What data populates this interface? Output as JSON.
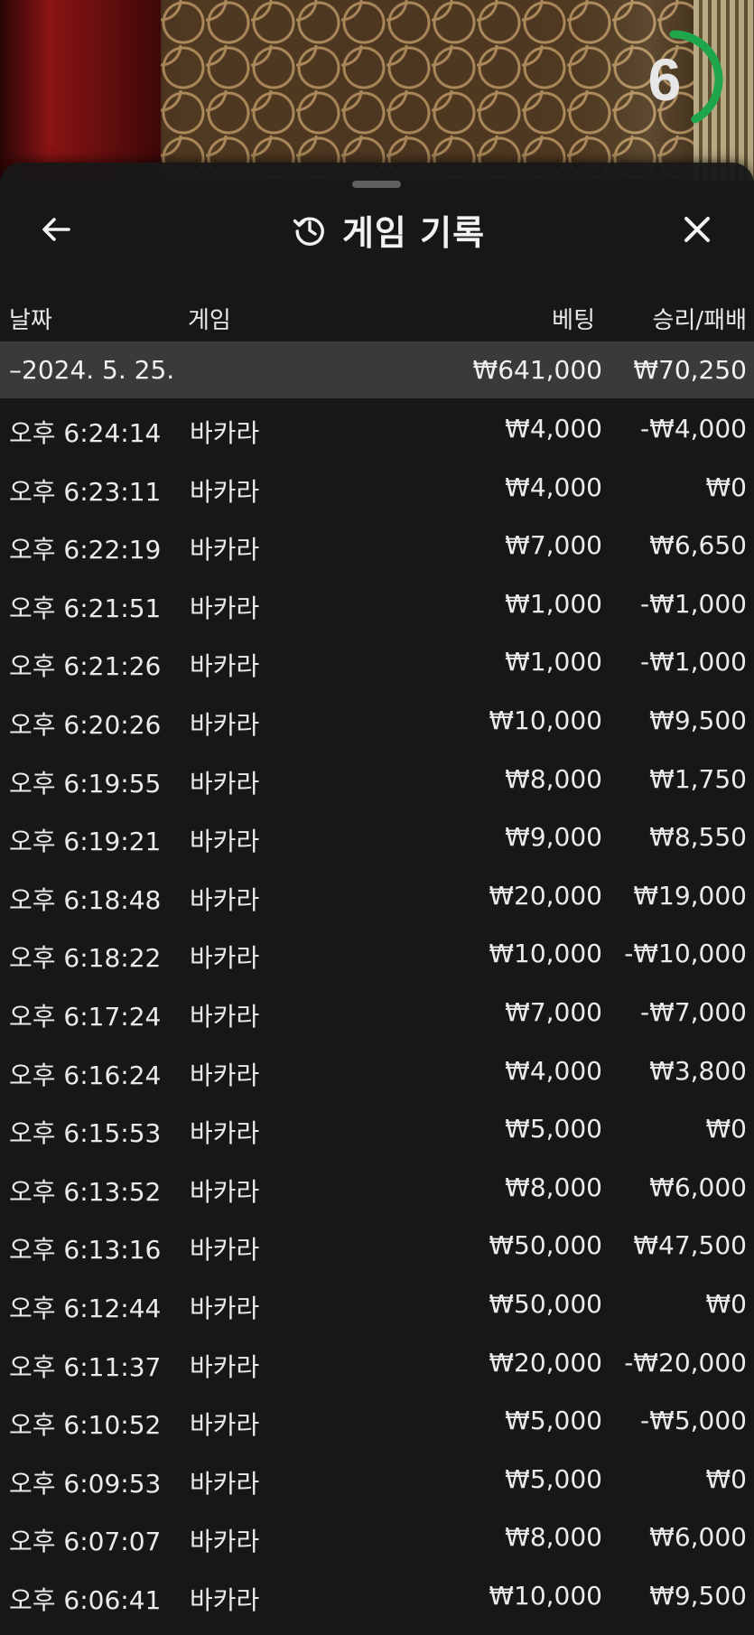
{
  "timer": {
    "value": "6",
    "accent": "#1fa64a",
    "progress": 0.42
  },
  "header": {
    "title": "게임 기록",
    "back_icon": "arrow-left-icon",
    "history_icon": "history-icon",
    "close_icon": "close-icon"
  },
  "columns": {
    "date": "날짜",
    "game": "게임",
    "bet": "베팅",
    "win_loss": "승리/패배"
  },
  "summary": {
    "date": "–2024. 5. 25.",
    "bet": "₩641,000",
    "win_loss": "₩70,250"
  },
  "rows": [
    {
      "time": "오후 6:24:14",
      "game": "바카라",
      "bet": "₩4,000",
      "win_loss": "-₩4,000"
    },
    {
      "time": "오후 6:23:11",
      "game": "바카라",
      "bet": "₩4,000",
      "win_loss": "₩0"
    },
    {
      "time": "오후 6:22:19",
      "game": "바카라",
      "bet": "₩7,000",
      "win_loss": "₩6,650"
    },
    {
      "time": "오후 6:21:51",
      "game": "바카라",
      "bet": "₩1,000",
      "win_loss": "-₩1,000"
    },
    {
      "time": "오후 6:21:26",
      "game": "바카라",
      "bet": "₩1,000",
      "win_loss": "-₩1,000"
    },
    {
      "time": "오후 6:20:26",
      "game": "바카라",
      "bet": "₩10,000",
      "win_loss": "₩9,500"
    },
    {
      "time": "오후 6:19:55",
      "game": "바카라",
      "bet": "₩8,000",
      "win_loss": "₩1,750"
    },
    {
      "time": "오후 6:19:21",
      "game": "바카라",
      "bet": "₩9,000",
      "win_loss": "₩8,550"
    },
    {
      "time": "오후 6:18:48",
      "game": "바카라",
      "bet": "₩20,000",
      "win_loss": "₩19,000"
    },
    {
      "time": "오후 6:18:22",
      "game": "바카라",
      "bet": "₩10,000",
      "win_loss": "-₩10,000"
    },
    {
      "time": "오후 6:17:24",
      "game": "바카라",
      "bet": "₩7,000",
      "win_loss": "-₩7,000"
    },
    {
      "time": "오후 6:16:24",
      "game": "바카라",
      "bet": "₩4,000",
      "win_loss": "₩3,800"
    },
    {
      "time": "오후 6:15:53",
      "game": "바카라",
      "bet": "₩5,000",
      "win_loss": "₩0"
    },
    {
      "time": "오후 6:13:52",
      "game": "바카라",
      "bet": "₩8,000",
      "win_loss": "₩6,000"
    },
    {
      "time": "오후 6:13:16",
      "game": "바카라",
      "bet": "₩50,000",
      "win_loss": "₩47,500"
    },
    {
      "time": "오후 6:12:44",
      "game": "바카라",
      "bet": "₩50,000",
      "win_loss": "₩0"
    },
    {
      "time": "오후 6:11:37",
      "game": "바카라",
      "bet": "₩20,000",
      "win_loss": "-₩20,000"
    },
    {
      "time": "오후 6:10:52",
      "game": "바카라",
      "bet": "₩5,000",
      "win_loss": "-₩5,000"
    },
    {
      "time": "오후 6:09:53",
      "game": "바카라",
      "bet": "₩5,000",
      "win_loss": "₩0"
    },
    {
      "time": "오후 6:07:07",
      "game": "바카라",
      "bet": "₩8,000",
      "win_loss": "₩6,000"
    },
    {
      "time": "오후 6:06:41",
      "game": "바카라",
      "bet": "₩10,000",
      "win_loss": "₩9,500"
    }
  ]
}
